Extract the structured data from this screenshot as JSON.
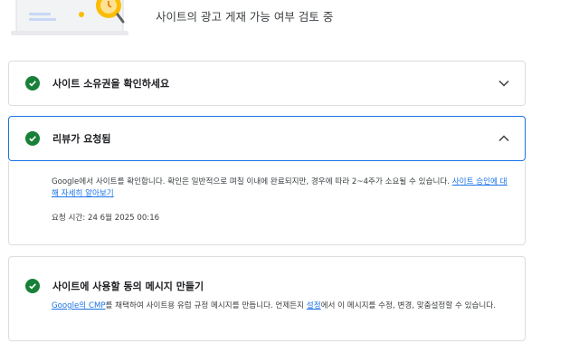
{
  "header": {
    "status_text": "사이트의 광고 게재 가능 여부 검토 중"
  },
  "cards": {
    "ownership": {
      "title": "사이트 소유권을 확인하세요",
      "state": "collapsed"
    },
    "review": {
      "title": "리뷰가 요청됨",
      "state": "expanded",
      "description": "Google에서 사이트를 확인합니다. 확인은 일반적으로 며칠 이내에 완료되지만, 경우에 따라 2~4주가 소요될 수 있습니다.",
      "link_text": "사이트 승인에 대해 자세히 알아보기",
      "request_time": "요청 시간: 24 6월 2025 00:16"
    },
    "consent": {
      "title": "사이트에 사용할 동의 메시지 만들기",
      "cmp_link": "Google의 CMP",
      "body_part1": "를 채택하여 사이트용 유럽 규정 메시지를 만듭니다. 언제든지 ",
      "settings_link": "설정",
      "body_part2": "에서 이 메시지를 수정, 변경, 맞춤설정할 수 있습니다."
    }
  },
  "colors": {
    "accent": "#1a73e8",
    "success": "#188038",
    "border": "#dadce0"
  },
  "icons": [
    "check-circle-icon",
    "chevron-down-icon",
    "chevron-up-icon",
    "review-illustration"
  ]
}
